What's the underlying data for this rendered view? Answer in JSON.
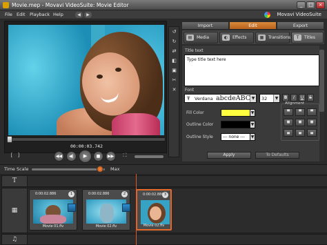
{
  "window": {
    "title": "Movie.mep - Movavi VideoSuite: Movie Editor",
    "controls": [
      "_",
      "□",
      "×"
    ]
  },
  "menu": {
    "items": [
      "File",
      "Edit",
      "Playback",
      "Help"
    ],
    "brand": "Movavi VideoSuite"
  },
  "preview": {
    "timecode": "00:00:03.742"
  },
  "editor": {
    "tabs": [
      "Import",
      "Edit",
      "Export"
    ],
    "active_tab": "Edit",
    "subtabs": [
      "Media",
      "Effects",
      "Transitions",
      "Titles"
    ],
    "title_text_label": "Title text",
    "title_text_value": "Type title text here",
    "font_label": "Font",
    "font_name": "Verdana",
    "font_preview": "abcdeABCDE",
    "font_size": "32",
    "format_buttons": [
      "B",
      "I",
      "U",
      "S"
    ],
    "fill_color_label": "Fill Color",
    "fill_color": "#ffff40",
    "outline_color_label": "Outline Color",
    "outline_color": "#000000",
    "outline_style_label": "Outline Style",
    "outline_style_value": "--- none ---",
    "alignment_label": "Alignment",
    "apply_label": "Apply",
    "defaults_label": "To Defaults"
  },
  "timescale": {
    "label": "Time Scale",
    "max_label": "Max"
  },
  "timeline": {
    "clips": [
      {
        "duration": "0:00:02.886",
        "number": "1",
        "name": "Movie 01.flv"
      },
      {
        "duration": "0:00:02.886",
        "number": "2",
        "name": "Movie 02.flv"
      },
      {
        "duration": "0:00:02.886",
        "number": "3",
        "name": "Movie 02.flv"
      }
    ]
  },
  "colors": {
    "accent": "#e66b2a",
    "active_tab": "#c8702a",
    "background": "#2b2b2b"
  },
  "icons": [
    "app-icon",
    "back-icon",
    "forward-icon",
    "movavi-logo-icon",
    "play-icon",
    "stop-icon",
    "rewind-icon",
    "fast-forward-icon",
    "rotate-left-icon",
    "rotate-right-icon",
    "text-track-icon",
    "video-track-icon",
    "audio-track-icon"
  ]
}
